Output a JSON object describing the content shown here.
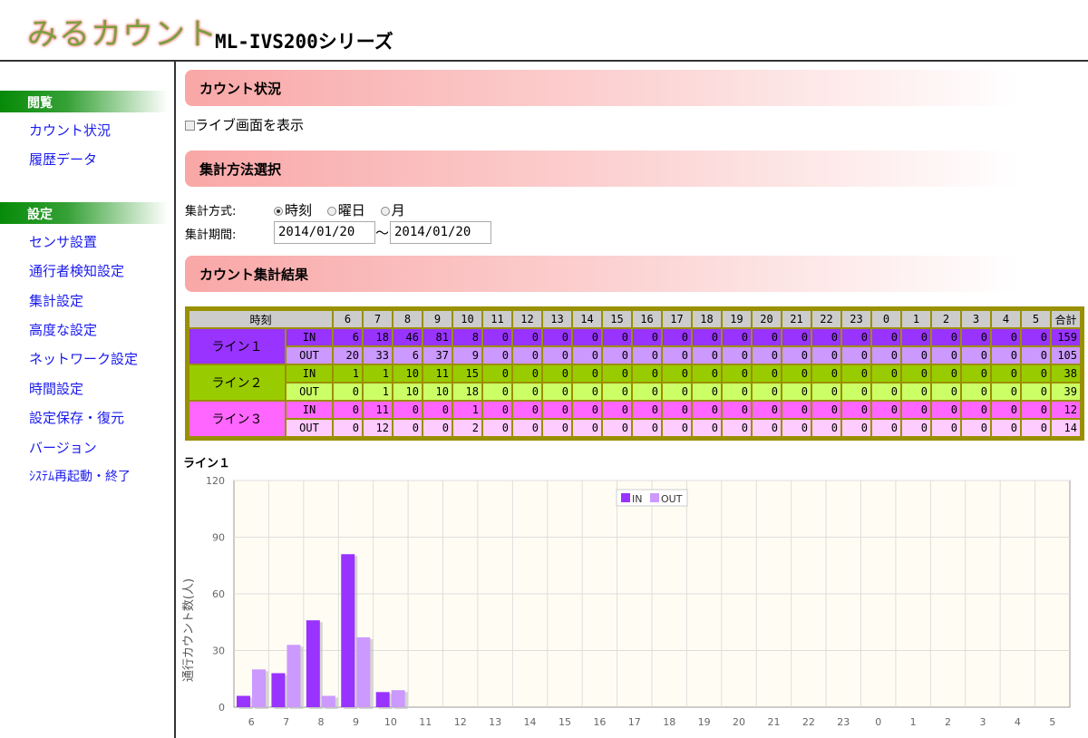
{
  "header": {
    "logo": "みるカウント",
    "model": "ML-IVS200シリーズ"
  },
  "sidebar": {
    "sections": [
      {
        "title": "閲覧",
        "items": [
          "カウント状況",
          "履歴データ"
        ]
      },
      {
        "title": "設定",
        "items": [
          "センサ設置",
          "通行者検知設定",
          "集計設定",
          "高度な設定",
          "ネットワーク設定",
          "時間設定",
          "設定保存・復元",
          "バージョン",
          "ｼｽﾃﾑ再起動・終了"
        ]
      }
    ]
  },
  "main": {
    "section1": "カウント状況",
    "live_label": "ライブ画面を表示",
    "section2": "集計方法選択",
    "method_label": "集計方式:",
    "methods": [
      "時刻",
      "曜日",
      "月"
    ],
    "method_selected": 0,
    "period_label": "集計期間:",
    "from": "2014/01/20",
    "tilde": "〜",
    "to": "2014/01/20",
    "section3": "カウント集計結果"
  },
  "table": {
    "time_header": "時刻",
    "total_header": "合計",
    "hours": [
      "6",
      "7",
      "8",
      "9",
      "10",
      "11",
      "12",
      "13",
      "14",
      "15",
      "16",
      "17",
      "18",
      "19",
      "20",
      "21",
      "22",
      "23",
      "0",
      "1",
      "2",
      "3",
      "4",
      "5"
    ],
    "lines": [
      {
        "name": "ライン１",
        "in_color": "#9933ff",
        "out_color": "#cc99ff",
        "rows": [
          {
            "dir": "IN",
            "values": [
              6,
              18,
              46,
              81,
              8,
              0,
              0,
              0,
              0,
              0,
              0,
              0,
              0,
              0,
              0,
              0,
              0,
              0,
              0,
              0,
              0,
              0,
              0,
              0
            ],
            "total": 159
          },
          {
            "dir": "OUT",
            "values": [
              20,
              33,
              6,
              37,
              9,
              0,
              0,
              0,
              0,
              0,
              0,
              0,
              0,
              0,
              0,
              0,
              0,
              0,
              0,
              0,
              0,
              0,
              0,
              0
            ],
            "total": 105
          }
        ]
      },
      {
        "name": "ライン２",
        "in_color": "#99cc00",
        "out_color": "#ccff66",
        "rows": [
          {
            "dir": "IN",
            "values": [
              1,
              1,
              10,
              11,
              15,
              0,
              0,
              0,
              0,
              0,
              0,
              0,
              0,
              0,
              0,
              0,
              0,
              0,
              0,
              0,
              0,
              0,
              0,
              0
            ],
            "total": 38
          },
          {
            "dir": "OUT",
            "values": [
              0,
              1,
              10,
              10,
              18,
              0,
              0,
              0,
              0,
              0,
              0,
              0,
              0,
              0,
              0,
              0,
              0,
              0,
              0,
              0,
              0,
              0,
              0,
              0
            ],
            "total": 39
          }
        ]
      },
      {
        "name": "ライン３",
        "in_color": "#ff66ff",
        "out_color": "#ffccff",
        "rows": [
          {
            "dir": "IN",
            "values": [
              0,
              11,
              0,
              0,
              1,
              0,
              0,
              0,
              0,
              0,
              0,
              0,
              0,
              0,
              0,
              0,
              0,
              0,
              0,
              0,
              0,
              0,
              0,
              0
            ],
            "total": 12
          },
          {
            "dir": "OUT",
            "values": [
              0,
              12,
              0,
              0,
              2,
              0,
              0,
              0,
              0,
              0,
              0,
              0,
              0,
              0,
              0,
              0,
              0,
              0,
              0,
              0,
              0,
              0,
              0,
              0
            ],
            "total": 14
          }
        ]
      }
    ]
  },
  "chart_data": {
    "type": "bar",
    "title": "ライン１",
    "ylabel": "通行カウント数(人)",
    "xlabel": "",
    "ylim": [
      0,
      120
    ],
    "yticks": [
      0,
      30,
      60,
      90,
      120
    ],
    "grid": true,
    "legend": "top-center",
    "categories": [
      "6",
      "7",
      "8",
      "9",
      "10",
      "11",
      "12",
      "13",
      "14",
      "15",
      "16",
      "17",
      "18",
      "19",
      "20",
      "21",
      "22",
      "23",
      "0",
      "1",
      "2",
      "3",
      "4",
      "5"
    ],
    "series": [
      {
        "name": "IN",
        "color": "#9933ff",
        "values": [
          6,
          18,
          46,
          81,
          8,
          0,
          0,
          0,
          0,
          0,
          0,
          0,
          0,
          0,
          0,
          0,
          0,
          0,
          0,
          0,
          0,
          0,
          0,
          0
        ]
      },
      {
        "name": "OUT",
        "color": "#cc99ff",
        "values": [
          20,
          33,
          6,
          37,
          9,
          0,
          0,
          0,
          0,
          0,
          0,
          0,
          0,
          0,
          0,
          0,
          0,
          0,
          0,
          0,
          0,
          0,
          0,
          0
        ]
      }
    ]
  }
}
